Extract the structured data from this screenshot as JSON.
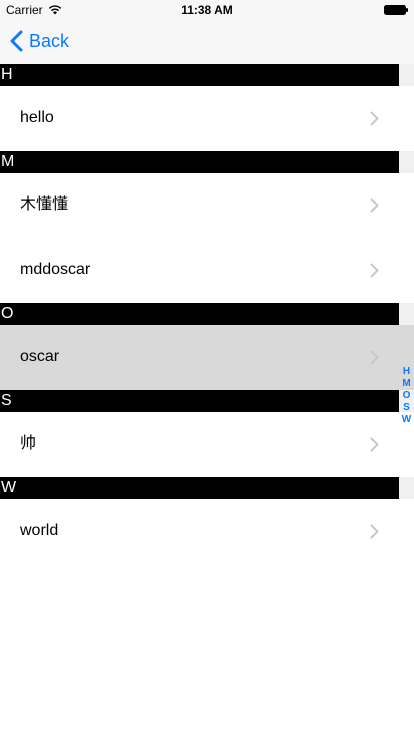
{
  "status_bar": {
    "carrier": "Carrier",
    "time": "11:38 AM"
  },
  "nav": {
    "back_label": "Back"
  },
  "colors": {
    "tint": "#0a7aff",
    "section_header_bg": "#000000",
    "section_header_text": "#ffffff",
    "selected_row_bg": "#d9d9d9"
  },
  "sections": [
    {
      "title": "H",
      "rows": [
        {
          "label": "hello"
        }
      ]
    },
    {
      "title": "M",
      "rows": [
        {
          "label": "木懂懂"
        },
        {
          "label": "mddoscar"
        }
      ]
    },
    {
      "title": "O",
      "rows": [
        {
          "label": "oscar",
          "selected": true
        }
      ]
    },
    {
      "title": "S",
      "rows": [
        {
          "label": "帅"
        }
      ]
    },
    {
      "title": "W",
      "rows": [
        {
          "label": "world"
        }
      ]
    }
  ],
  "section_index": [
    "H",
    "M",
    "O",
    "S",
    "W"
  ]
}
